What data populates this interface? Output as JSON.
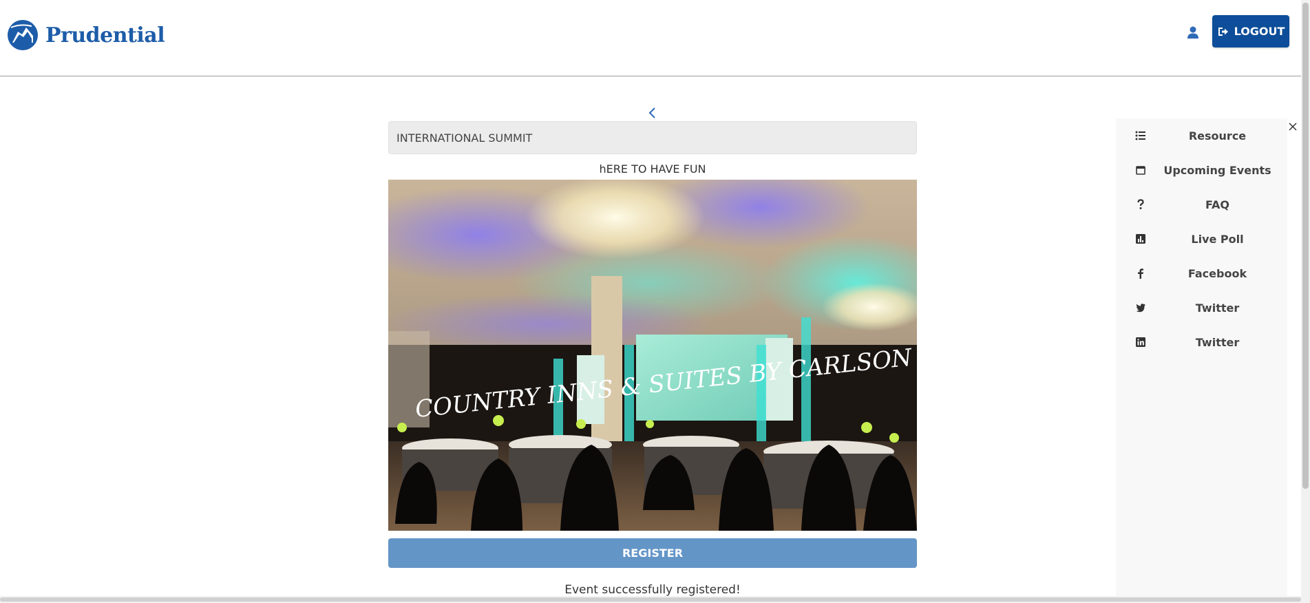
{
  "header": {
    "logo_text": "Prudential",
    "user_icon": "user-icon",
    "logout_label": "LOGOUT",
    "logout_icon": "sign-out-icon"
  },
  "event": {
    "title": "INTERNATIONAL SUMMIT",
    "subtitle": "hERE TO HAVE FUN",
    "image_caption": "COUNTRY INNS & SUITES BY CARLSON Awards",
    "register_label": "REGISTER",
    "status_message": "Event successfully registered!"
  },
  "sidebar": {
    "items": [
      {
        "label": "Resource",
        "icon": "list-icon"
      },
      {
        "label": "Upcoming Events",
        "icon": "calendar-icon"
      },
      {
        "label": "FAQ",
        "icon": "question-icon"
      },
      {
        "label": "Live Poll",
        "icon": "poll-icon"
      },
      {
        "label": "Facebook",
        "icon": "facebook-icon"
      },
      {
        "label": "Twitter",
        "icon": "twitter-icon"
      },
      {
        "label": "Twitter",
        "icon": "linkedin-icon"
      }
    ]
  },
  "colors": {
    "brand": "#1d5ca8",
    "logout_bg": "#0d4d99",
    "register_bg": "#6495c7"
  }
}
